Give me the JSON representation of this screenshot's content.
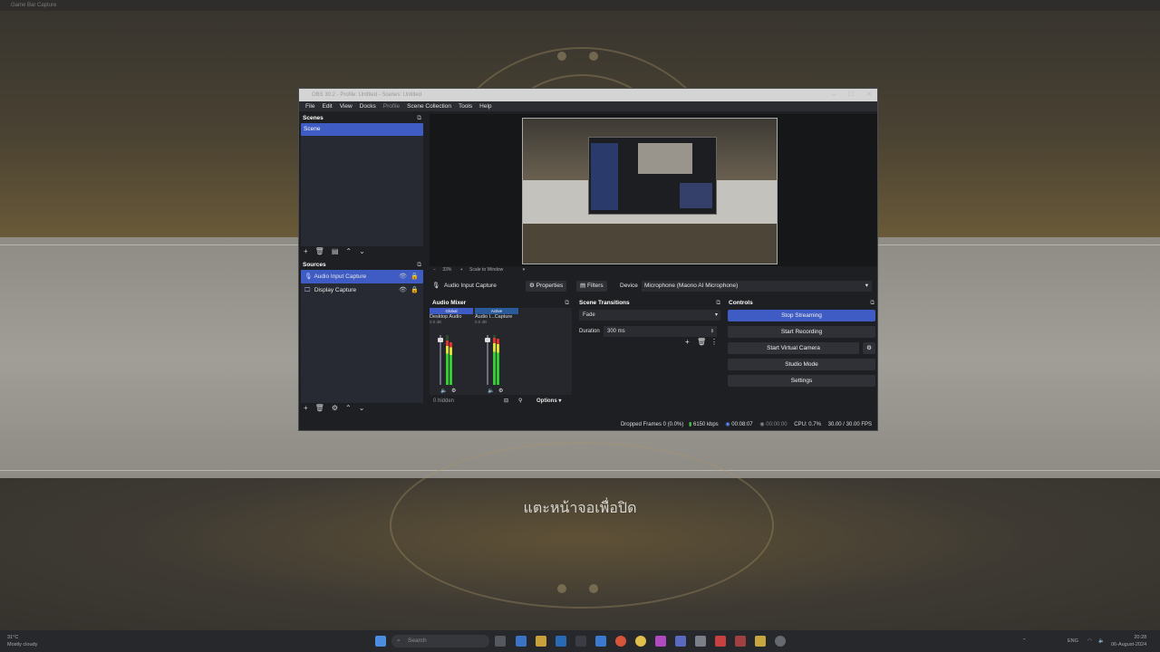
{
  "desktop": {
    "window_caption": "Game Bar Capture",
    "overlay_text": "แตะหน้าจอเพื่อปิด"
  },
  "obs": {
    "title": "OBS 30.2 - Profile: Untitled - Scenes: Untitled",
    "menu": [
      "File",
      "Edit",
      "View",
      "Docks",
      "Profile",
      "Scene Collection",
      "Tools",
      "Help"
    ],
    "scenes": {
      "header": "Scenes",
      "items": [
        "Scene"
      ]
    },
    "sources": {
      "header": "Sources",
      "items": [
        "Audio Input Capture",
        "Display Capture"
      ]
    },
    "preview": {
      "zoom": "33%",
      "scale_mode": "Scale to Window"
    },
    "props_bar": {
      "source_name": "Audio Input Capture",
      "properties": "Properties",
      "filters": "Filters",
      "device_label": "Device",
      "device_value": "Microphone (Maono AI Microphone)"
    },
    "audio_mixer": {
      "header": "Audio Mixer",
      "channels": [
        {
          "tag": "Global",
          "name": "Desktop Audio",
          "db": "0.0 dB"
        },
        {
          "tag": "Active",
          "name": "Audio I...Capture",
          "db": "0.0 dB"
        }
      ],
      "hidden": "0 hidden",
      "options": "Options"
    },
    "scene_transitions": {
      "header": "Scene Transitions",
      "transition": "Fade",
      "duration_label": "Duration",
      "duration_value": "300 ms"
    },
    "controls": {
      "header": "Controls",
      "stop_streaming": "Stop Streaming",
      "start_recording": "Start Recording",
      "start_virtual_camera": "Start Virtual Camera",
      "studio_mode": "Studio Mode",
      "settings": "Settings"
    },
    "status": {
      "dropped_frames": "Dropped Frames 0 (0.0%)",
      "bitrate": "6150 kbps",
      "stream_time": "00:08:07",
      "rec_time": "00:00:00",
      "cpu": "CPU: 0.7%",
      "fps": "30.00 / 30.00 FPS"
    }
  },
  "taskbar": {
    "search_placeholder": "Search",
    "weather_temp": "31°C",
    "weather_desc": "Mostly cloudy",
    "language": "ENG",
    "time": "20:28",
    "date": "06-August-2024"
  },
  "colors": {
    "accent": "#3f5bc4",
    "obs_bg": "#1e1f22"
  }
}
